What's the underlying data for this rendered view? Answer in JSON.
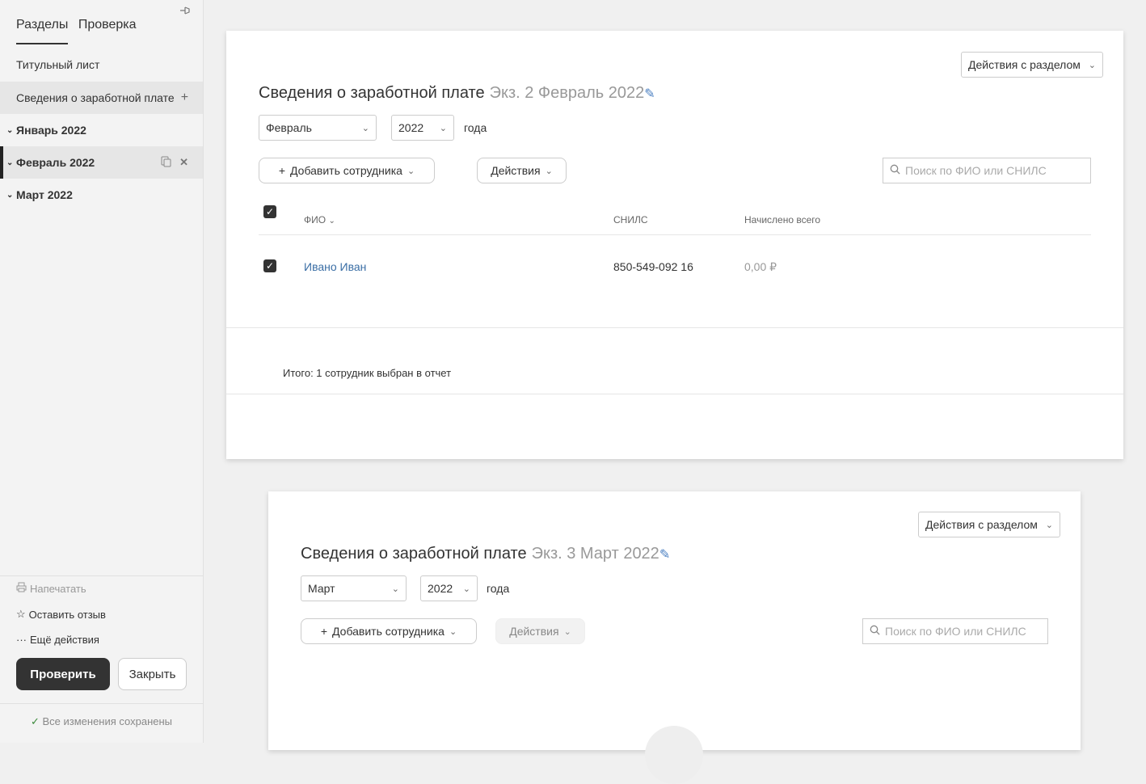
{
  "sidebar": {
    "tabs": [
      "Разделы",
      "Проверка"
    ],
    "items": {
      "title_page": "Титульный лист",
      "salary_info": "Сведения о заработной плате",
      "months": [
        "Январь 2022",
        "Февраль 2022",
        "Март 2022"
      ]
    },
    "actions": {
      "print": "Напечатать",
      "feedback": "Оставить отзыв",
      "more": "Ещё действия"
    },
    "buttons": {
      "check": "Проверить",
      "close": "Закрыть"
    },
    "saved_status": "Все изменения сохранены"
  },
  "card1": {
    "section_actions": "Действия с разделом",
    "title": "Сведения о заработной плате",
    "subtitle": "Экз. 2 Февраль 2022",
    "month": "Февраль",
    "year": "2022",
    "year_suffix": "года",
    "add_employee": "Добавить сотрудника",
    "actions": "Действия",
    "search_placeholder": "Поиск по ФИО или СНИЛС",
    "columns": {
      "fio": "ФИО",
      "snils": "СНИЛС",
      "accrued": "Начислено всего"
    },
    "rows": [
      {
        "fio": "Ивано Иван",
        "snils": "850-549-092 16",
        "accrued": "0,00 ₽"
      }
    ],
    "total": "Итого: 1 сотрудник выбран в отчет"
  },
  "card2": {
    "section_actions": "Действия с разделом",
    "title": "Сведения о заработной плате",
    "subtitle": "Экз. 3 Март 2022",
    "month": "Март",
    "year": "2022",
    "year_suffix": "года",
    "add_employee": "Добавить сотрудника",
    "actions": "Действия",
    "search_placeholder": "Поиск по ФИО или СНИЛС"
  }
}
